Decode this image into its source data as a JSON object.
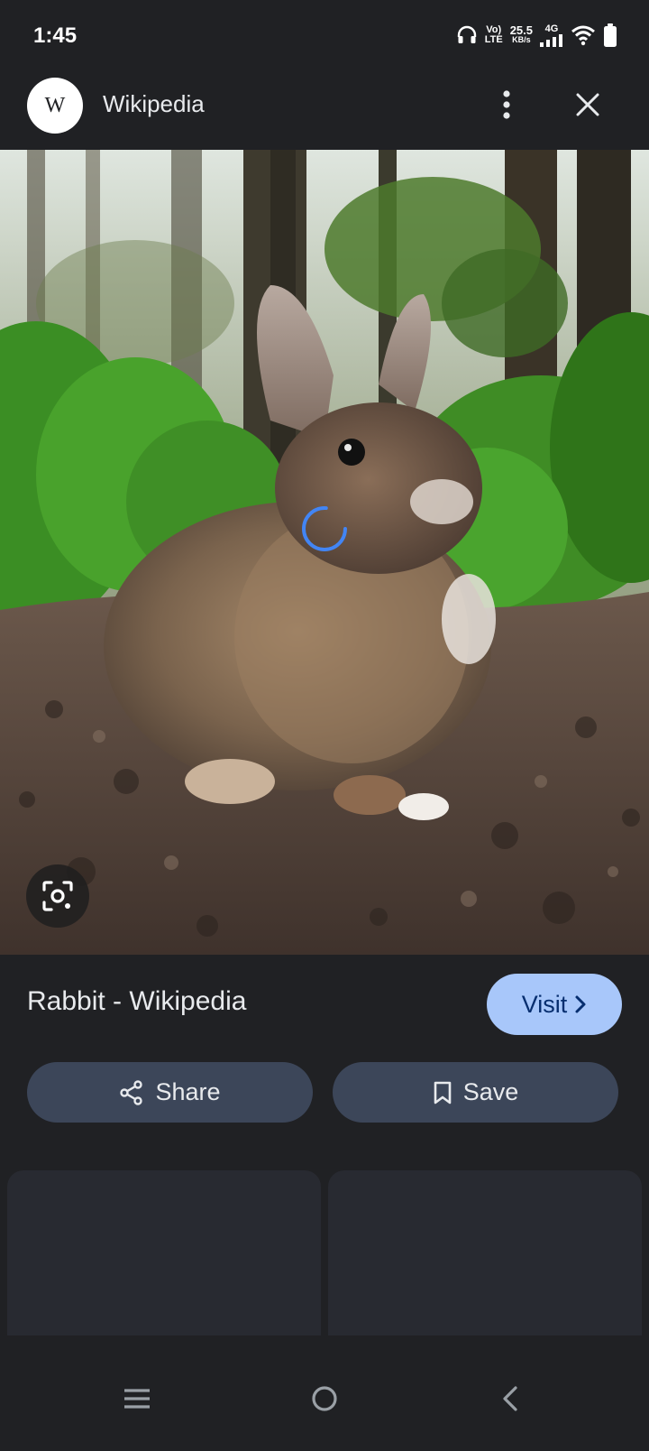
{
  "status_bar": {
    "time": "1:45",
    "volte_top": "Vo)",
    "volte_bottom": "LTE",
    "speed_value": "25.5",
    "speed_unit": "KB/s",
    "network": "4G",
    "icons": [
      "headphones-icon",
      "signal-icon",
      "wifi-icon",
      "battery-icon"
    ]
  },
  "header": {
    "logo_letter": "W",
    "site_name": "Wikipedia",
    "more_icon": "more-vert-icon",
    "close_icon": "close-icon"
  },
  "result": {
    "title": "Rabbit - Wikipedia",
    "visit_label": "Visit",
    "share_label": "Share",
    "save_label": "Save"
  },
  "colors": {
    "background": "#202124",
    "visit_button": "#a8c7fa",
    "action_button": "#3c4659",
    "loading_spinner": "#4285f4"
  },
  "nav_bar": {
    "icons": [
      "menu-icon",
      "home-icon",
      "back-icon"
    ]
  }
}
